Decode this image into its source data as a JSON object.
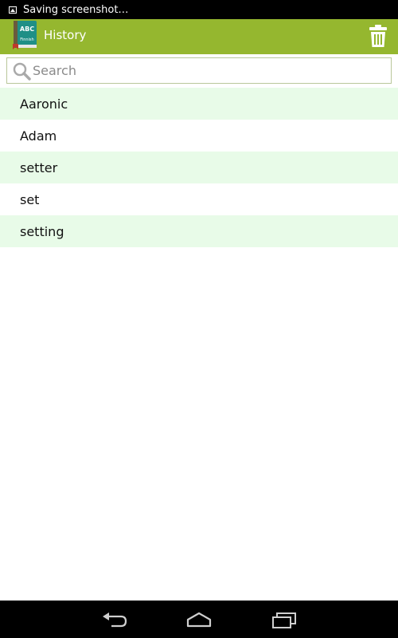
{
  "status_bar": {
    "text": "Saving screenshot…"
  },
  "action_bar": {
    "app_icon_label": "ABC",
    "app_icon_sublabel": "Finnish",
    "title": "History",
    "accent_color": "#95b72f"
  },
  "search": {
    "placeholder": "Search",
    "value": ""
  },
  "history": {
    "items": [
      {
        "label": "Aaronic"
      },
      {
        "label": "Adam"
      },
      {
        "label": "setter"
      },
      {
        "label": "set"
      },
      {
        "label": "setting"
      }
    ],
    "alt_row_color": "#e8fbe8"
  },
  "icons": {
    "status": "screenshot-icon",
    "app": "book-icon",
    "delete": "trash-icon",
    "search": "search-icon",
    "back": "back-icon",
    "home": "home-icon",
    "recents": "recents-icon"
  }
}
